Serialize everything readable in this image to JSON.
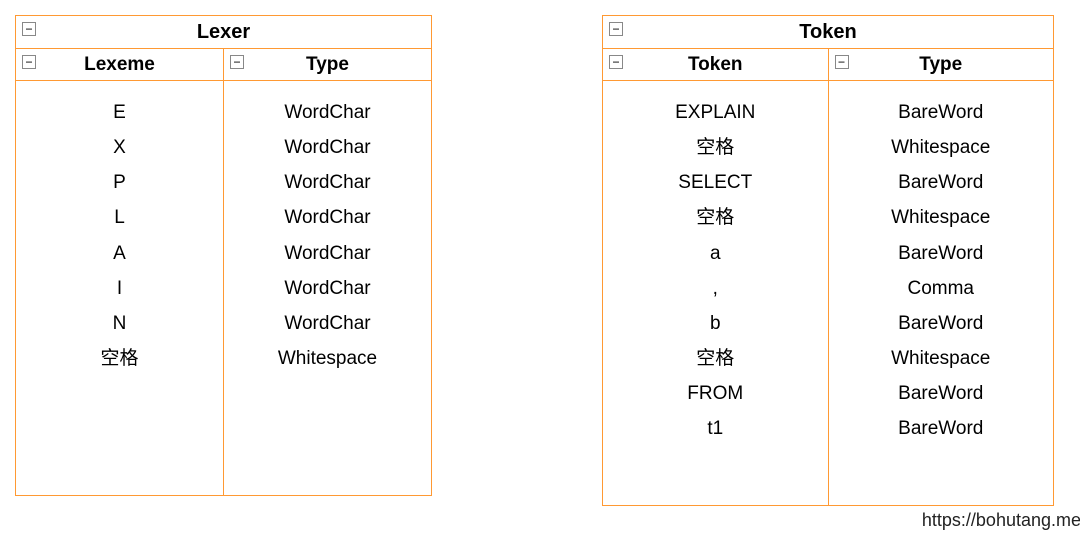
{
  "lexer": {
    "title": "Lexer",
    "col1_head": "Lexeme",
    "col2_head": "Type",
    "rows": [
      {
        "lex": "E",
        "type": "WordChar"
      },
      {
        "lex": "X",
        "type": "WordChar"
      },
      {
        "lex": "P",
        "type": "WordChar"
      },
      {
        "lex": "L",
        "type": "WordChar"
      },
      {
        "lex": "A",
        "type": "WordChar"
      },
      {
        "lex": "I",
        "type": "WordChar"
      },
      {
        "lex": "N",
        "type": "WordChar"
      },
      {
        "lex": "空格",
        "type": "Whitespace"
      }
    ]
  },
  "token": {
    "title": "Token",
    "col1_head": "Token",
    "col2_head": "Type",
    "rows": [
      {
        "tok": "EXPLAIN",
        "type": "BareWord"
      },
      {
        "tok": "空格",
        "type": "Whitespace"
      },
      {
        "tok": "SELECT",
        "type": "BareWord"
      },
      {
        "tok": "空格",
        "type": "Whitespace"
      },
      {
        "tok": "a",
        "type": "BareWord"
      },
      {
        "tok": ",",
        "type": "Comma"
      },
      {
        "tok": "b",
        "type": "BareWord"
      },
      {
        "tok": "空格",
        "type": "Whitespace"
      },
      {
        "tok": "FROM",
        "type": "BareWord"
      },
      {
        "tok": "t1",
        "type": "BareWord"
      }
    ]
  },
  "footer": "https://bohutang.me"
}
